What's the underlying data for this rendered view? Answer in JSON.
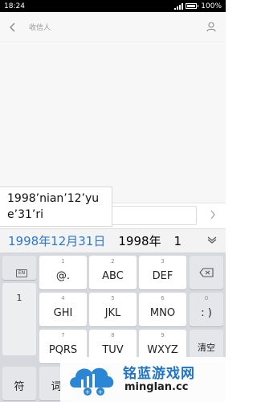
{
  "status": {
    "time": "18:24",
    "battery": "100%"
  },
  "header": {
    "recipient_placeholder": "收信人"
  },
  "composition": {
    "text": "1998’nian’12’yue’31’ri"
  },
  "candidates": [
    {
      "text": "1998年12月31日"
    },
    {
      "text": "1998年"
    },
    {
      "text": "1"
    }
  ],
  "keyboard": {
    "lang_label": "EN",
    "side_label": "1",
    "keys": [
      {
        "num": "1",
        "label": "@."
      },
      {
        "num": "2",
        "label": "ABC"
      },
      {
        "num": "3",
        "label": "DEF"
      },
      {
        "num": "4",
        "label": "GHI"
      },
      {
        "num": "5",
        "label": "JKL"
      },
      {
        "num": "6",
        "label": "MNO"
      },
      {
        "num": "0",
        "label": ": )"
      },
      {
        "num": "7",
        "label": "PQRS"
      },
      {
        "num": "8",
        "label": "TUV"
      },
      {
        "num": "9",
        "label": "WXYZ"
      },
      {
        "num": "",
        "label": "清空"
      },
      {
        "num": "",
        "label": "符"
      },
      {
        "num": "",
        "label": "词"
      }
    ]
  },
  "watermark": {
    "name": "铭蓝游戏网",
    "domain": "minglan.cc"
  },
  "colors": {
    "accent": "#2b78d4",
    "keyboard_bg": "#d5d8dc"
  }
}
